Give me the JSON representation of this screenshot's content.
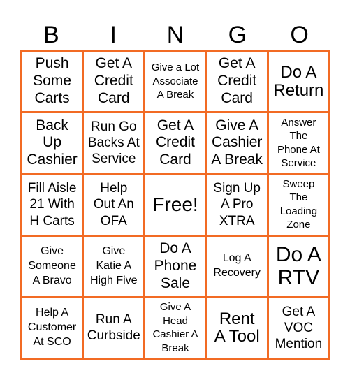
{
  "card": {
    "header": [
      "B",
      "I",
      "N",
      "G",
      "O"
    ],
    "border_color": "#F26B24",
    "cells": [
      [
        "Push\nSome\nCarts",
        "Get A\nCredit\nCard",
        "Give a Lot\nAssociate\nA Break",
        "Get A\nCredit\nCard",
        "Do A\nReturn"
      ],
      [
        "Back\nUp\nCashier",
        "Run Go\nBacks At\nService",
        "Get A\nCredit\nCard",
        "Give A\nCashier\nA Break",
        "Answer\nThe\nPhone At\nService"
      ],
      [
        "Fill Aisle\n21 With\nH Carts",
        "Help\nOut An\nOFA",
        "Free!",
        "Sign Up\nA Pro\nXTRA",
        "Sweep\nThe\nLoading\nZone"
      ],
      [
        "Give\nSomeone\nA Bravo",
        "Give\nKatie A\nHigh Five",
        "Do A\nPhone\nSale",
        "Log A\nRecovery",
        "Do A\nRTV"
      ],
      [
        "Help A\nCustomer\nAt SCO",
        "Run A\nCurbside",
        "Give A\nHead\nCashier A\nBreak",
        "Rent\nA Tool",
        "Get A\nVOC\nMention"
      ]
    ]
  }
}
